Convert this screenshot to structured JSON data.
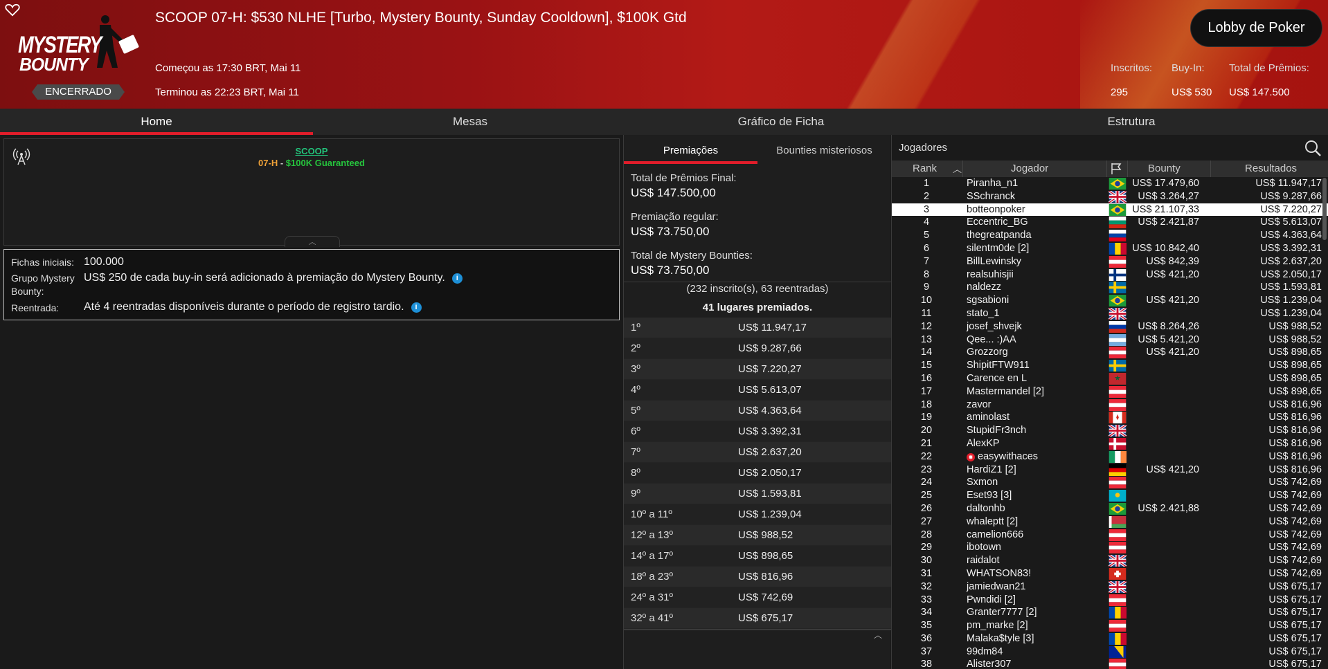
{
  "header": {
    "title": "SCOOP 07-H: $530 NLHE [Turbo, Mystery Bounty, Sunday Cooldown], $100K Gtd",
    "logo_line1": "MYSTERY",
    "logo_line2": "BOUNTY",
    "status": "ENCERRADO",
    "started": "Começou as 17:30 BRT, Mai 11",
    "ended": "Terminou as 22:23 BRT, Mai 11",
    "lobby_button": "Lobby de Poker",
    "stats": {
      "registered_label": "Inscritos:",
      "registered_value": "295",
      "buyin_label": "Buy-In:",
      "buyin_value": "US$ 530",
      "prizepool_label": "Total de Prêmios:",
      "prizepool_value": "US$ 147.500"
    }
  },
  "tabs": [
    "Home",
    "Mesas",
    "Gráfico de Ficha",
    "Estrutura"
  ],
  "info": {
    "series_link": "SCOOP",
    "event_code": "07-H",
    "separator": " - ",
    "guarantee": "$100K Guaranteed"
  },
  "details": {
    "starting_chips_label": "Fichas iniciais:",
    "starting_chips_value": "100.000",
    "mystery_label_1": "Grupo Mystery",
    "mystery_label_2": "Bounty:",
    "mystery_value": "US$ 250 de cada buy-in será adicionado à premiação do Mystery Bounty.",
    "reentry_label": "Reentrada:",
    "reentry_value": "Até 4 reentradas disponíveis durante o período de registro tardio."
  },
  "prizes": {
    "tabs": [
      "Premiações",
      "Bounties misteriosos"
    ],
    "final_label": "Total de Prêmios Final:",
    "final_value": "US$ 147.500,00",
    "regular_label": "Premiação regular:",
    "regular_value": "US$ 73.750,00",
    "mystery_label": "Total de Mystery Bounties:",
    "mystery_value": "US$ 73.750,00",
    "entries": "(232 inscrito(s), 63 reentradas)",
    "paid_places": "41 lugares premiados.",
    "payouts": [
      {
        "place": "1º",
        "amount": "US$ 11.947,17"
      },
      {
        "place": "2º",
        "amount": "US$ 9.287,66"
      },
      {
        "place": "3º",
        "amount": "US$ 7.220,27"
      },
      {
        "place": "4º",
        "amount": "US$ 5.613,07"
      },
      {
        "place": "5º",
        "amount": "US$ 4.363,64"
      },
      {
        "place": "6º",
        "amount": "US$ 3.392,31"
      },
      {
        "place": "7º",
        "amount": "US$ 2.637,20"
      },
      {
        "place": "8º",
        "amount": "US$ 2.050,17"
      },
      {
        "place": "9º",
        "amount": "US$ 1.593,81"
      },
      {
        "place": "10º a 11º",
        "amount": "US$ 1.239,04"
      },
      {
        "place": "12º a 13º",
        "amount": "US$ 988,52"
      },
      {
        "place": "14º a 17º",
        "amount": "US$ 898,65"
      },
      {
        "place": "18º a 23º",
        "amount": "US$ 816,96"
      },
      {
        "place": "24º a 31º",
        "amount": "US$ 742,69"
      },
      {
        "place": "32º a 41º",
        "amount": "US$ 675,17"
      }
    ]
  },
  "players": {
    "title": "Jogadores",
    "columns": [
      "Rank",
      "Jogador",
      "Bounty",
      "Resultados"
    ],
    "rows": [
      {
        "rank": "1",
        "name": "Piranha_n1",
        "flag": "br",
        "bounty": "US$ 17.479,60",
        "result": "US$ 11.947,17"
      },
      {
        "rank": "2",
        "name": "SSchranck",
        "flag": "gb",
        "bounty": "US$ 3.264,27",
        "result": "US$ 9.287,66"
      },
      {
        "rank": "3",
        "name": "botteonpoker",
        "flag": "br",
        "bounty": "US$ 21.107,33",
        "result": "US$ 7.220,27",
        "highlight": true
      },
      {
        "rank": "4",
        "name": "Eccentric_BG",
        "flag": "bg",
        "bounty": "US$ 2.421,87",
        "result": "US$ 5.613,07"
      },
      {
        "rank": "5",
        "name": "thegreatpanda",
        "flag": "si",
        "bounty": "",
        "result": "US$ 4.363,64"
      },
      {
        "rank": "6",
        "name": "silentm0de [2]",
        "flag": "md",
        "bounty": "US$ 10.842,40",
        "result": "US$ 3.392,31"
      },
      {
        "rank": "7",
        "name": "BillLewinsky",
        "flag": "at",
        "bounty": "US$ 842,39",
        "result": "US$ 2.637,20"
      },
      {
        "rank": "8",
        "name": "realsuhisjii",
        "flag": "fi",
        "bounty": "US$ 421,20",
        "result": "US$ 2.050,17"
      },
      {
        "rank": "9",
        "name": "naldezz",
        "flag": "se",
        "bounty": "",
        "result": "US$ 1.593,81"
      },
      {
        "rank": "10",
        "name": "sgsabioni",
        "flag": "br",
        "bounty": "US$ 421,20",
        "result": "US$ 1.239,04"
      },
      {
        "rank": "11",
        "name": "stato_1",
        "flag": "gb",
        "bounty": "",
        "result": "US$ 1.239,04"
      },
      {
        "rank": "12",
        "name": "josef_shvejk",
        "flag": "ru",
        "bounty": "US$ 8.264,26",
        "result": "US$ 988,52"
      },
      {
        "rank": "13",
        "name": "Qee... :)AA",
        "flag": "ar",
        "bounty": "US$ 5.421,20",
        "result": "US$ 988,52"
      },
      {
        "rank": "14",
        "name": "Grozzorg",
        "flag": "at",
        "bounty": "US$ 421,20",
        "result": "US$ 898,65"
      },
      {
        "rank": "15",
        "name": "ShipitFTW911",
        "flag": "se",
        "bounty": "",
        "result": "US$ 898,65"
      },
      {
        "rank": "16",
        "name": "Carence en L",
        "flag": "ma",
        "bounty": "",
        "result": "US$ 898,65"
      },
      {
        "rank": "17",
        "name": "Mastermandel [2]",
        "flag": "at",
        "bounty": "",
        "result": "US$ 898,65"
      },
      {
        "rank": "18",
        "name": "zavor",
        "flag": "at",
        "bounty": "",
        "result": "US$ 816,96"
      },
      {
        "rank": "19",
        "name": "aminolast",
        "flag": "ca",
        "bounty": "",
        "result": "US$ 816,96"
      },
      {
        "rank": "20",
        "name": "StupidFr3nch",
        "flag": "gb",
        "bounty": "",
        "result": "US$ 816,96"
      },
      {
        "rank": "21",
        "name": "AlexKP",
        "flag": "dk",
        "bounty": "",
        "result": "US$ 816,96"
      },
      {
        "rank": "22",
        "name": "easywithaces",
        "flag": "ie",
        "bounty": "",
        "result": "US$ 816,96",
        "knockout": true
      },
      {
        "rank": "23",
        "name": "HardiZ1 [2]",
        "flag": "de",
        "bounty": "US$ 421,20",
        "result": "US$ 816,96"
      },
      {
        "rank": "24",
        "name": "Sxmon",
        "flag": "at",
        "bounty": "",
        "result": "US$ 742,69"
      },
      {
        "rank": "25",
        "name": "Eset93 [3]",
        "flag": "kz",
        "bounty": "",
        "result": "US$ 742,69"
      },
      {
        "rank": "26",
        "name": "daltonhb",
        "flag": "br",
        "bounty": "US$ 2.421,88",
        "result": "US$ 742,69"
      },
      {
        "rank": "27",
        "name": "whaleptt [2]",
        "flag": "by",
        "bounty": "",
        "result": "US$ 742,69"
      },
      {
        "rank": "28",
        "name": "camelion666",
        "flag": "at",
        "bounty": "",
        "result": "US$ 742,69"
      },
      {
        "rank": "29",
        "name": "ibotown",
        "flag": "at",
        "bounty": "",
        "result": "US$ 742,69"
      },
      {
        "rank": "30",
        "name": "raidalot",
        "flag": "gb",
        "bounty": "",
        "result": "US$ 742,69"
      },
      {
        "rank": "31",
        "name": "WHATSON83!",
        "flag": "ch",
        "bounty": "",
        "result": "US$ 742,69"
      },
      {
        "rank": "32",
        "name": "jamiedwan21",
        "flag": "gb",
        "bounty": "",
        "result": "US$ 675,17"
      },
      {
        "rank": "33",
        "name": "Pwndidi [2]",
        "flag": "at",
        "bounty": "",
        "result": "US$ 675,17"
      },
      {
        "rank": "34",
        "name": "Granter7777 [2]",
        "flag": "md",
        "bounty": "",
        "result": "US$ 675,17"
      },
      {
        "rank": "35",
        "name": "pm_marke [2]",
        "flag": "at",
        "bounty": "",
        "result": "US$ 675,17"
      },
      {
        "rank": "36",
        "name": "Malaka$tyle [3]",
        "flag": "md",
        "bounty": "",
        "result": "US$ 675,17"
      },
      {
        "rank": "37",
        "name": "99dm84",
        "flag": "ba",
        "bounty": "",
        "result": "US$ 675,17"
      },
      {
        "rank": "38",
        "name": "Alister307",
        "flag": "at",
        "bounty": "",
        "result": "US$ 675,17"
      }
    ]
  },
  "colors": {
    "accent": "#e11d2a",
    "header_red": "#9a1214",
    "link_green": "#22c27a",
    "event_orange": "#f0a238",
    "guarantee_green": "#26c43d"
  }
}
